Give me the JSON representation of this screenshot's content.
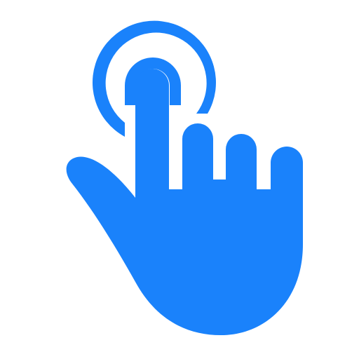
{
  "icon": {
    "name": "tap-gesture-icon",
    "color": "#1a82fb",
    "background": "#ffffff"
  }
}
